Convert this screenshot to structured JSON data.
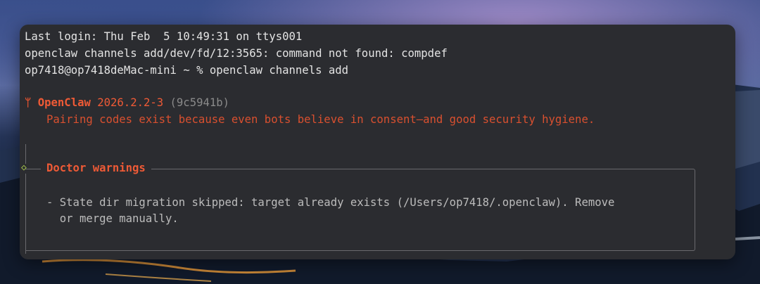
{
  "terminal": {
    "lines": [
      "Last login: Thu Feb  5 10:49:31 on ttys001",
      "openclaw channels add/dev/fd/12:3565: command not found: compdef",
      "op7418@op7418deMac-mini ~ % openclaw channels add"
    ],
    "brand": {
      "icon": "ᛘ",
      "icon_name": "claw-logo-icon",
      "name": "OpenClaw",
      "version": "2026.2.2-3",
      "hash": "(9c5941b)",
      "tagline": "Pairing codes exist because even bots believe in consent—and good security hygiene."
    },
    "doctor": {
      "marker": "◇",
      "title": "Doctor warnings",
      "warning_line1": "- State dir migration skipped: target already exists (/Users/op7418/.openclaw). Remove",
      "warning_line2": "  or merge manually."
    }
  },
  "colors": {
    "background": "#2b2c30",
    "text": "#e4e4e4",
    "accent": "#ee5a36",
    "muted": "#8a8a8a",
    "marker": "#a9c94c"
  }
}
